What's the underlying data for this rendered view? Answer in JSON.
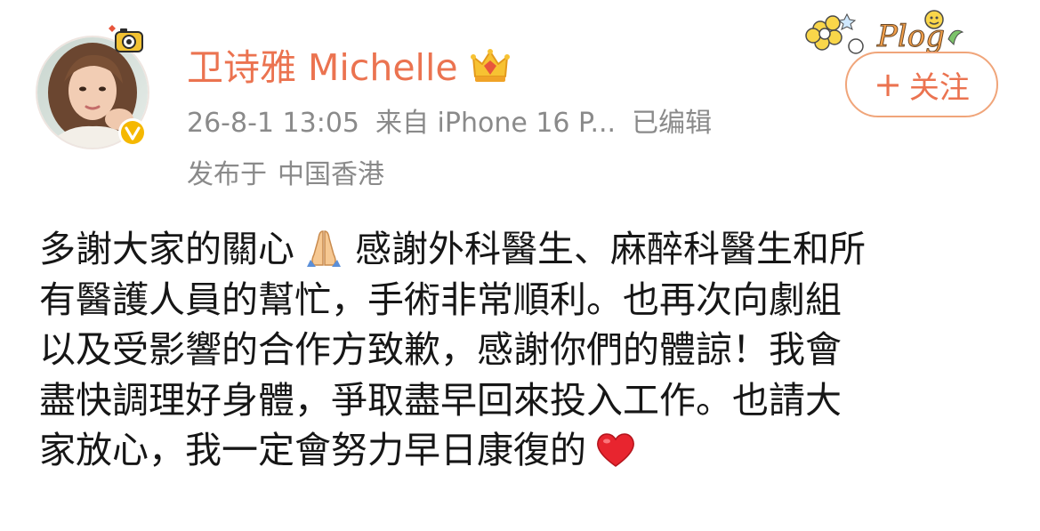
{
  "user": {
    "name": "卫诗雅 Michelle",
    "avatar_icon": "avatar-portrait",
    "verified_icon": "verified-badge-icon",
    "membership_icon": "crown-icon"
  },
  "meta": {
    "timestamp": "26-8-1 13:05",
    "source": "来自 iPhone 16 P...",
    "edited": "已编辑",
    "location_prefix": "发布于",
    "location": "中国香港"
  },
  "follow_button": {
    "plus": "+",
    "label": "关注"
  },
  "post": {
    "line1_a": "多謝大家的關心",
    "line1_emoji": "folded-hands",
    "line1_b": "感謝外科醫生、麻醉科醫生和所",
    "line2": "有醫護人員的幫忙，手術非常順利。也再次向劇組",
    "line3": "以及受影響的合作方致歉，感謝你們的體諒！我會",
    "line4": "盡快調理好身體，爭取盡早回來投入工作。也請大",
    "line5": "家放心，我一定會努力早日康復的",
    "line5_emoji": "red-heart"
  },
  "colors": {
    "accent": "#eb7350",
    "meta_text": "#8a8a8a",
    "body_text": "#161616",
    "verified_yellow": "#f5b800"
  }
}
